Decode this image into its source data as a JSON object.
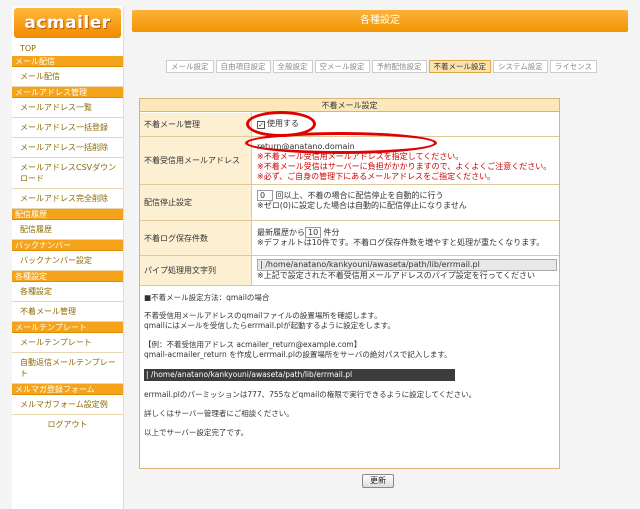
{
  "app": {
    "logo": "acmailer",
    "page_title": "各種設定"
  },
  "sidebar": {
    "top": "TOP",
    "sections": [
      {
        "title": "メール配信",
        "items": [
          "メール配信"
        ]
      },
      {
        "title": "メールアドレス管理",
        "items": [
          "メールアドレス一覧",
          "メールアドレス一括登録",
          "メールアドレス一括削除",
          "メールアドレスCSVダウンロード",
          "メールアドレス完全削除"
        ]
      },
      {
        "title": "配信履歴",
        "items": [
          "配信履歴"
        ]
      },
      {
        "title": "バックナンバー",
        "items": [
          "バックナンバー設定"
        ]
      },
      {
        "title": "各種設定",
        "items": [
          "各種設定",
          "不着メール管理"
        ]
      },
      {
        "title": "メールテンプレート",
        "items": [
          "メールテンプレート",
          "自動返信メールテンプレート"
        ]
      },
      {
        "title": "メルマガ登録フォーム",
        "items": [
          "メルマガフォーム設定例"
        ]
      }
    ],
    "logout": "ログアウト"
  },
  "tabs": [
    {
      "label": "メール設定",
      "active": false
    },
    {
      "label": "自由項目設定",
      "active": false
    },
    {
      "label": "全般設定",
      "active": false
    },
    {
      "label": "空メール設定",
      "active": false
    },
    {
      "label": "予約配信設定",
      "active": false
    },
    {
      "label": "不着メール設定",
      "active": true
    },
    {
      "label": "システム設定",
      "active": false
    },
    {
      "label": "ライセンス",
      "active": false
    }
  ],
  "panel": {
    "title": "不着メール設定",
    "manage": {
      "label": "不着メール管理",
      "checkbox_label": "使用する",
      "checked": true
    },
    "address": {
      "label": "不着受信用メールアドレス",
      "value": "return@anatano.domain",
      "notes": [
        "※不着メール受信用メールアドレスを指定してください。",
        "※不着メール受信はサーバーに負担がかかりますので、よくよくご注意ください。",
        "※必ず、ご自身の管理下にあるメールアドレスをご指定ください。"
      ]
    },
    "stop": {
      "label": "配信停止設定",
      "value": "0",
      "text1": "回以上、不着の場合に配信停止を自動的に行う",
      "text2": "※ゼロ(0)に設定した場合は自動的に配信停止になりません"
    },
    "log": {
      "label": "不着ログ保存件数",
      "prefix": "最新履歴から",
      "value": "10",
      "suffix": "件分",
      "note": "※デフォルトは10件です。不着ログ保存件数を増やすと処理が重たくなります。"
    },
    "pipe": {
      "label": "パイプ処理用文字列",
      "value": "| /home/anatano/kankyouni/awaseta/path/lib/errmail.pl",
      "note": "※上記で設定された不着受信用メールアドレスのパイプ設定を行ってください"
    },
    "instructions": {
      "heading": "■不着メール設定方法：qmailの場合",
      "p1a": "不着受信用メールアドレスのqmailファイルの設置場所を確認します。",
      "p1b": "qmailにはメールを受信したらerrmail.plが起動するように設定をします。",
      "p2a": "【例：不着受信用アドレス acmailer_return@example.com】",
      "p2b": "qmail-acmailer_return を作成しerrmail.plの設置場所をサーバの絶対パスで記入します。",
      "code": "| /home/anatano/kankyouni/awaseta/path/lib/errmail.pl",
      "p3": "errmail.plのパーミッションは777、755などqmailの権限で実行できるように設定してください。",
      "p4": "詳しくはサーバー管理者にご相談ください。",
      "p5": "以上でサーバー設定完了です。"
    },
    "update_button": "更新"
  },
  "colors": {
    "accent": "#f29400",
    "highlight_ring": "#e00000",
    "warning_text": "#d00000"
  }
}
